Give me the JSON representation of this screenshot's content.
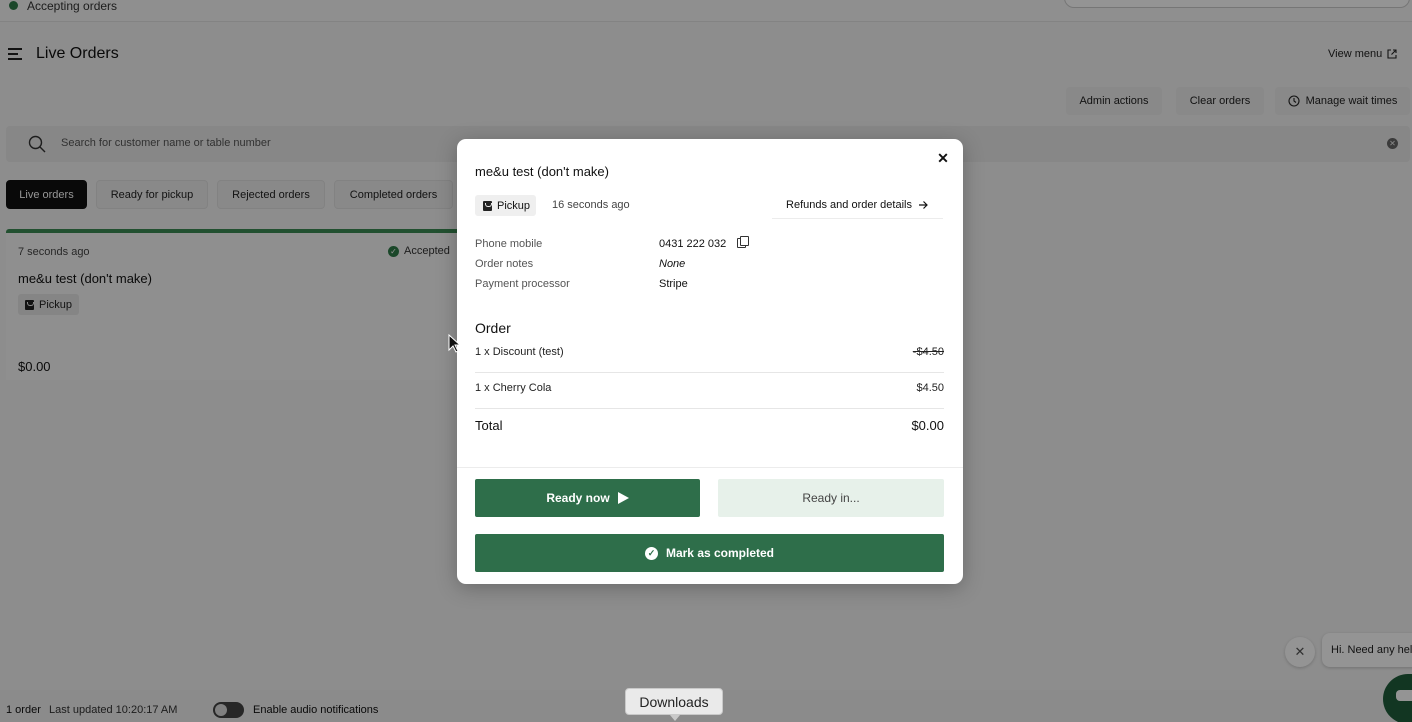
{
  "status": {
    "label": "Accepting orders"
  },
  "header": {
    "title": "Live Orders",
    "view_menu": "View menu"
  },
  "actions": {
    "admin": "Admin actions",
    "clear": "Clear orders",
    "wait": "Manage wait times"
  },
  "search": {
    "placeholder": "Search for customer name or table number"
  },
  "tabs": [
    {
      "label": "Live orders"
    },
    {
      "label": "Ready for pickup"
    },
    {
      "label": "Rejected orders"
    },
    {
      "label": "Completed orders"
    }
  ],
  "card": {
    "time": "7 seconds ago",
    "status": "Accepted",
    "name": "me&u test (don't make)",
    "tag": "Pickup",
    "total": "$0.00"
  },
  "footer": {
    "count": "1 order",
    "updated": "Last updated 10:20:17 AM",
    "audio": "Enable audio notifications"
  },
  "downloads": "Downloads",
  "chat": {
    "text": "Hi. Need any hel"
  },
  "modal": {
    "title": "me&u test (don't make)",
    "tag": "Pickup",
    "ago": "16 seconds ago",
    "refunds": "Refunds and order details",
    "details": [
      {
        "label": "Phone mobile",
        "value": "0431 222 032"
      },
      {
        "label": "Order notes",
        "value": "None"
      },
      {
        "label": "Payment processor",
        "value": "Stripe"
      }
    ],
    "order_heading": "Order",
    "items": [
      {
        "name": "1 x Discount (test)",
        "price": "-$4.50"
      },
      {
        "name": "1 x Cherry Cola",
        "price": "$4.50"
      }
    ],
    "total_label": "Total",
    "total_value": "$0.00",
    "ready_now": "Ready now",
    "ready_in": "Ready in...",
    "complete": "Mark as completed"
  },
  "colors": {
    "brand_green": "#2e6e4a",
    "accent_green": "#3c8a54"
  }
}
